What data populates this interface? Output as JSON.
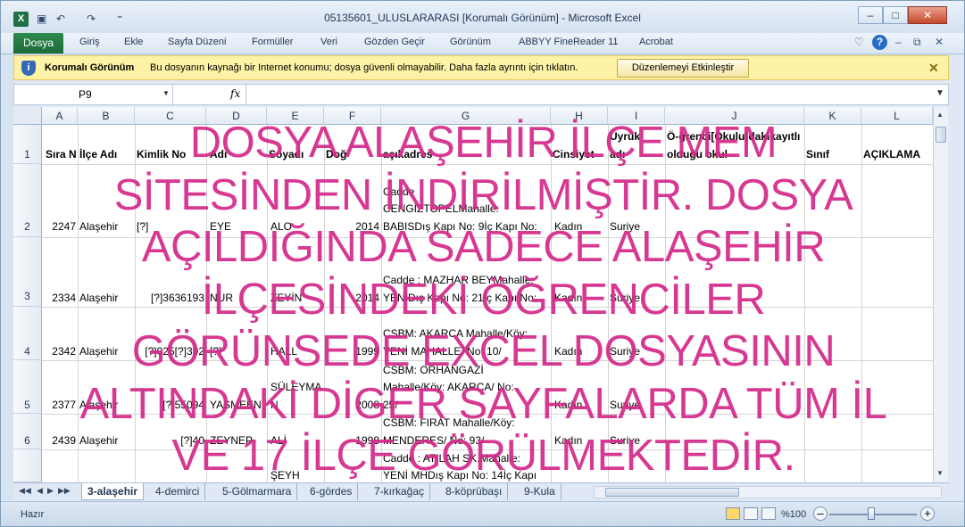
{
  "window": {
    "title": "05135601_ULUSLARARASI  [Korumalı Görünüm] - Microsoft Excel",
    "app_icon": "X",
    "qa_undo": "↶",
    "qa_redo": "↷",
    "qa_more": "⁼",
    "btn_min": "–",
    "btn_max": "□",
    "btn_close": "✕"
  },
  "ribbon": {
    "file": "Dosya",
    "tabs": [
      "Giriş",
      "Ekle",
      "Sayfa Düzeni",
      "Formüller",
      "Veri",
      "Gözden Geçir",
      "Görünüm",
      "ABBYY FineReader 11",
      "Acrobat"
    ],
    "help": "?",
    "caret": "♡",
    "min": "–",
    "restore": "⧉",
    "close": "✕"
  },
  "protected_view": {
    "icon": "i",
    "title": "Korumalı Görünüm",
    "message": "Bu dosyanın kaynağı bir Internet konumu; dosya güvenli olmayabilir. Daha fazla ayrıntı için tıklatın.",
    "button": "Düzenlemeyi Etkinleştir",
    "close": "✕"
  },
  "formula_bar": {
    "cell_ref": "P9",
    "fx": "fx",
    "dropdown": "▼",
    "expand": "▼",
    "value": ""
  },
  "grid": {
    "columns": [
      "A",
      "B",
      "C",
      "D",
      "E",
      "F",
      "G",
      "H",
      "I",
      "J",
      "K",
      "L"
    ],
    "row_numbers": [
      "1",
      "2",
      "3",
      "4",
      "5",
      "6",
      ""
    ],
    "header": {
      "a": "Sıra N",
      "b": "İlçe Adı",
      "c": "Kimlik No",
      "d": "Adı",
      "e": "Soyadı",
      "f": "Doğ",
      "g": "açıkadres",
      "h": "Cinsiyet",
      "i_top": "Uyruk",
      "i_bottom": "adı",
      "j_top": "Ö-ğrenci[Okulu]dakikayıtlı",
      "j_bottom": "olduğu okul",
      "k": "Sınıf",
      "l": "AÇIKLAMA"
    },
    "rows": [
      {
        "a": "2247",
        "b": "Alaşehir",
        "c": "[?]",
        "d": "EYE",
        "e": "ALO",
        "f": "2014",
        "g1": "Cadde",
        "g2": "CENGİZTOPELMahalle:",
        "g3": "BABISDış Kapı No: 9İç Kapı No:",
        "h": "Kadın",
        "i": "Suriye"
      },
      {
        "a": "2334",
        "b": "Alaşehir",
        "c": "[?]3636193",
        "d": "NUR",
        "e": "ZEYİN",
        "f": "2014",
        "g1": "Cadde : MAZHAR BEYMahalle:",
        "g2": "YENİDış Kapı No: 21İç Kapı No:",
        "g3": "",
        "h": "Kadın",
        "i": "Suriye"
      },
      {
        "a": "2342",
        "b": "Alaşehir",
        "c": "[?]025[?]392",
        "d": "[?]",
        "e": "HALL",
        "f": "1999",
        "g1": "CSBM: AKARCA Mahalle/Köy:",
        "g2": "YENİ MAHALLE/ No: 10/",
        "g3": "",
        "h": "Kadın",
        "i": "Suriye"
      },
      {
        "a": "2377",
        "b": "Alaşehir",
        "c": "[?]55094",
        "d": "YASMEEN",
        "e1": "SÜLEYMA",
        "e2": "N",
        "f": "2008",
        "g1": "CSBM: ORHANGAZİ",
        "g2": "Mahalle/Köy: AKARCA/ No:",
        "g3": "25/",
        "h": "Kadın",
        "i": "Suriye"
      },
      {
        "a": "2439",
        "b": "Alaşehir",
        "c": "[?]40",
        "d": "ZEYNEP",
        "e": "ALİ",
        "f": "1998",
        "g1": "CSBM: FIRAT Mahalle/Köy:",
        "g2": "MENDERES/ No: 93/",
        "g3": "",
        "h": "Kadın",
        "i": "Suriye"
      },
      {
        "a": "",
        "b": "",
        "c": "",
        "d": "",
        "e": "ŞEYH",
        "f": "",
        "g1": "Cadde : ATILAH SK.Mahalle:",
        "g2": "YENİ MHDış Kapı No: 14İç Kapı",
        "g3": "",
        "h": "",
        "i": ""
      }
    ]
  },
  "watermark": {
    "lines": [
      "DOSYA ALAŞEHİR İLÇE MEM",
      "SİTESİNDEN İNDİRİLMİŞTİR. DOSYA",
      "AÇILDIĞINDA SADECE ALAŞEHİR",
      "İLÇESİNDEKİ ÖĞRENCİLER",
      "GÖRÜNSEDE EXCEL DOSYASININ",
      "ALTINDAKİ DİGER SAYFALARDA TÜM İL",
      "VE 17 İLÇE GÖRÜLMEKTEDİR."
    ],
    "color": "#d42a8a"
  },
  "sheets": {
    "nav_first": "◀◀",
    "nav_prev": "◀",
    "nav_next": "▶",
    "nav_last": "▶▶",
    "tabs": [
      "3-alaşehir",
      "4-demirci",
      "5-Gölmarmara",
      "6-gördes",
      "7-kırkağaç",
      "8-köprübaşı",
      "9-Kula"
    ],
    "active": "3-alaşehir"
  },
  "status": {
    "text": "Hazır",
    "zoom": "%100",
    "zoom_minus": "–",
    "zoom_plus": "+"
  }
}
